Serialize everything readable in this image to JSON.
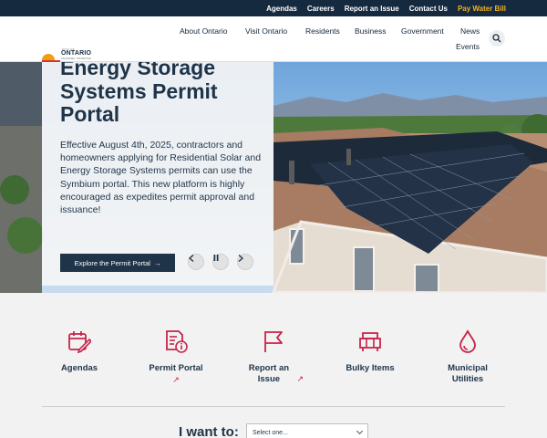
{
  "utility_nav": [
    {
      "label": "Agendas"
    },
    {
      "label": "Careers"
    },
    {
      "label": "Report an Issue"
    },
    {
      "label": "Contact Us"
    },
    {
      "label": "Pay Water Bill",
      "color": "#f1b320"
    }
  ],
  "logo": {
    "city_of": "CITY OF",
    "name": "ONTARIO",
    "tagline": "CALIFORNIA · DISTINCTIVE"
  },
  "main_nav": [
    {
      "label": "About Ontario"
    },
    {
      "label": "Visit Ontario"
    },
    {
      "label": "Residents"
    },
    {
      "label": "Business"
    },
    {
      "label": "Government"
    },
    {
      "label": "News"
    },
    {
      "label": "Events"
    }
  ],
  "search": {
    "icon": "search-icon"
  },
  "hero": {
    "title": "Energy Storage Systems Permit Portal",
    "body": "Effective August 4th, 2025, contractors and homeowners applying for Residential Solar and Energy Storage Systems permits can use the Symbium portal. This new platform is highly encouraged as expedites permit approval and issuance!",
    "cta_label": "Explore the Permit Portal",
    "cta_arrow": "→",
    "controls": {
      "prev": "‹",
      "pause": "❚❚",
      "next": "›"
    }
  },
  "quick_links": [
    {
      "label": "Agendas",
      "icon": "calendar-edit-icon",
      "external": false
    },
    {
      "label": "Permit Portal",
      "icon": "document-info-icon",
      "external": true
    },
    {
      "label": "Report an Issue",
      "icon": "flag-icon",
      "external": true
    },
    {
      "label": "Bulky Items",
      "icon": "couch-icon",
      "external": false
    },
    {
      "label": "Municipal Utilities",
      "icon": "water-drop-icon",
      "external": false
    }
  ],
  "i_want_to": {
    "label": "I want to:",
    "select_value": "Select one..."
  },
  "colors": {
    "navy": "#15293f",
    "accent": "#c8234a",
    "gold": "#f1b320"
  }
}
